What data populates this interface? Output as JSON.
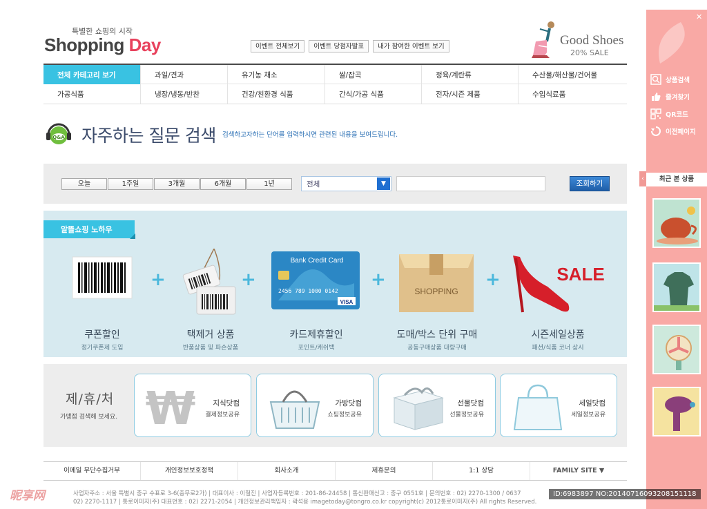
{
  "header": {
    "logo_sub": "특별한 쇼핑의 시작",
    "logo_part1": "Shopping ",
    "logo_part2": "Day",
    "links": [
      "이벤트 전체보기",
      "이벤트 당첨자발표",
      "내가 참여한 이벤트 보기"
    ],
    "promo_title": "Good Shoes",
    "promo_sub": "20% SALE"
  },
  "categories": {
    "row1": [
      "전체 카테고리 보기",
      "과일/견과",
      "유기농 채소",
      "쌀/잡곡",
      "정육/계란류",
      "수산물/해산물/건어물"
    ],
    "row2": [
      "가공식품",
      "냉장/냉동/반찬",
      "건강/친환경 식품",
      "간식/가공 식품",
      "전자/시즌 제품",
      "수입식료품"
    ]
  },
  "faq": {
    "title": "자주하는 질문 검색",
    "desc": "검색하고자하는 단어를 입력하시면 관련된 내용을 보여드립니다."
  },
  "search": {
    "periods": [
      "오늘",
      "1주일",
      "3개월",
      "6개월",
      "1년"
    ],
    "select_value": "전체",
    "input_value": "",
    "button": "조회하기"
  },
  "knowhow": {
    "tab": "알뜰쇼핑 노하우",
    "card_text": "Bank Credit Card",
    "card_number": "2456  789  1000  0142",
    "card_brand": "VISA",
    "box_text": "SHOPPING",
    "sale_text": "SALE",
    "items": [
      {
        "name": "쿠폰할인",
        "desc": "정기쿠폰제 도입"
      },
      {
        "name": "택제거 상품",
        "desc": "반품상품 및 파손상품"
      },
      {
        "name": "카드제휴할인",
        "desc": "포인트/캐쉬백"
      },
      {
        "name": "도매/박스 단위 구매",
        "desc": "공동구매상품 대량구매"
      },
      {
        "name": "시즌세일상품",
        "desc": "패션/식품 코너 상시"
      }
    ]
  },
  "partners": {
    "title": "제/휴/처",
    "sub": "가맹점 검색해 보세요.",
    "cards": [
      {
        "name": "지식닷컴",
        "desc": "결제정보공유"
      },
      {
        "name": "가방닷컴",
        "desc": "쇼핑정보공유"
      },
      {
        "name": "선물닷컴",
        "desc": "선물정보공유"
      },
      {
        "name": "세일닷컴",
        "desc": "세일정보공유"
      }
    ]
  },
  "footer": {
    "nav": [
      "이메일 무단수집거부",
      "개인정보보호정책",
      "회사소개",
      "제휴문의",
      "1:1 상담",
      "FAMILY SITE ▼"
    ],
    "address_line1": "사업자주소 : 서울 특별시 중구 수표로 3-6(충무로2가) | 대표이사 : 이철진 | 사업자등록번호 : 201-86-24458 | 통신판매신고 : 중구 0551호  |  문의번호 : 02) 2270-1300 / 0637",
    "address_line2": "02) 2270-1117 | 통로이미지(주) 대표번호 : 02) 2271-2054 | 개인정보관리책임자 : 곽석용 imagetoday@tongro.co.kr  copyright(c) 2012통로이미지(주) All rights Reserved."
  },
  "sidebar": {
    "menu": [
      "상품검색",
      "즐겨찾기",
      "QR코드",
      "이전페이지"
    ],
    "recent_label": "최근 본 상품"
  },
  "watermark": {
    "left": "昵享网",
    "right": "ID:6983897 NO:20140716093208151118"
  }
}
